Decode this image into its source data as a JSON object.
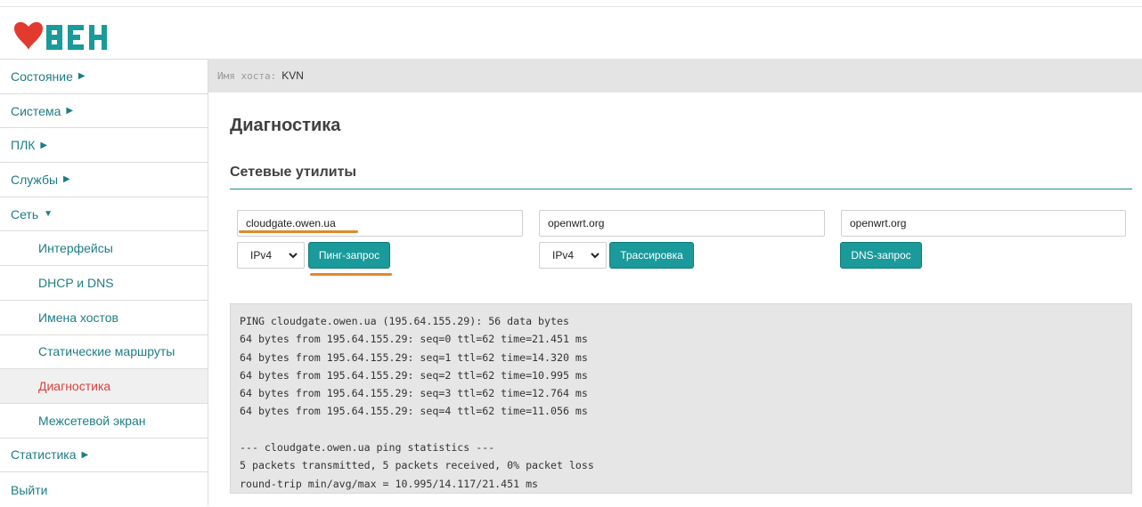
{
  "brand": {
    "logo_text": "ОВЕН",
    "accent": "#1a9a9a",
    "active_color": "#d9423c"
  },
  "sidebar": {
    "items": [
      {
        "label": "Состояние",
        "icon": "triangle-right-icon",
        "level": "top"
      },
      {
        "label": "Система",
        "icon": "triangle-right-icon",
        "level": "top"
      },
      {
        "label": "ПЛК",
        "icon": "triangle-right-icon",
        "level": "top"
      },
      {
        "label": "Службы",
        "icon": "triangle-right-icon",
        "level": "top"
      },
      {
        "label": "Сеть",
        "icon": "triangle-down-icon",
        "level": "top"
      },
      {
        "label": "Интерфейсы",
        "level": "sub"
      },
      {
        "label": "DHCP и DNS",
        "level": "sub"
      },
      {
        "label": "Имена хостов",
        "level": "sub"
      },
      {
        "label": "Статические маршруты",
        "level": "sub"
      },
      {
        "label": "Диагностика",
        "level": "sub",
        "active": true
      },
      {
        "label": "Межсетевой экран",
        "level": "sub"
      },
      {
        "label": "Статистика",
        "icon": "triangle-right-icon",
        "level": "top"
      },
      {
        "label": "Выйти",
        "level": "top"
      }
    ]
  },
  "host": {
    "label": "Имя хоста:",
    "value": "KVN"
  },
  "main": {
    "title": "Диагностика",
    "section_title": "Сетевые утилиты",
    "ping": {
      "value": "cloudgate.owen.ua",
      "family": "IPv4",
      "button": "Пинг-запрос"
    },
    "traceroute": {
      "value": "openwrt.org",
      "family": "IPv4",
      "button": "Трассировка"
    },
    "nslookup": {
      "value": "openwrt.org",
      "button": "DNS-запрос"
    },
    "output": "PING cloudgate.owen.ua (195.64.155.29): 56 data bytes\n64 bytes from 195.64.155.29: seq=0 ttl=62 time=21.451 ms\n64 bytes from 195.64.155.29: seq=1 ttl=62 time=14.320 ms\n64 bytes from 195.64.155.29: seq=2 ttl=62 time=10.995 ms\n64 bytes from 195.64.155.29: seq=3 ttl=62 time=12.764 ms\n64 bytes from 195.64.155.29: seq=4 ttl=62 time=11.056 ms\n\n--- cloudgate.owen.ua ping statistics ---\n5 packets transmitted, 5 packets received, 0% packet loss\nround-trip min/avg/max = 10.995/14.117/21.451 ms"
  }
}
